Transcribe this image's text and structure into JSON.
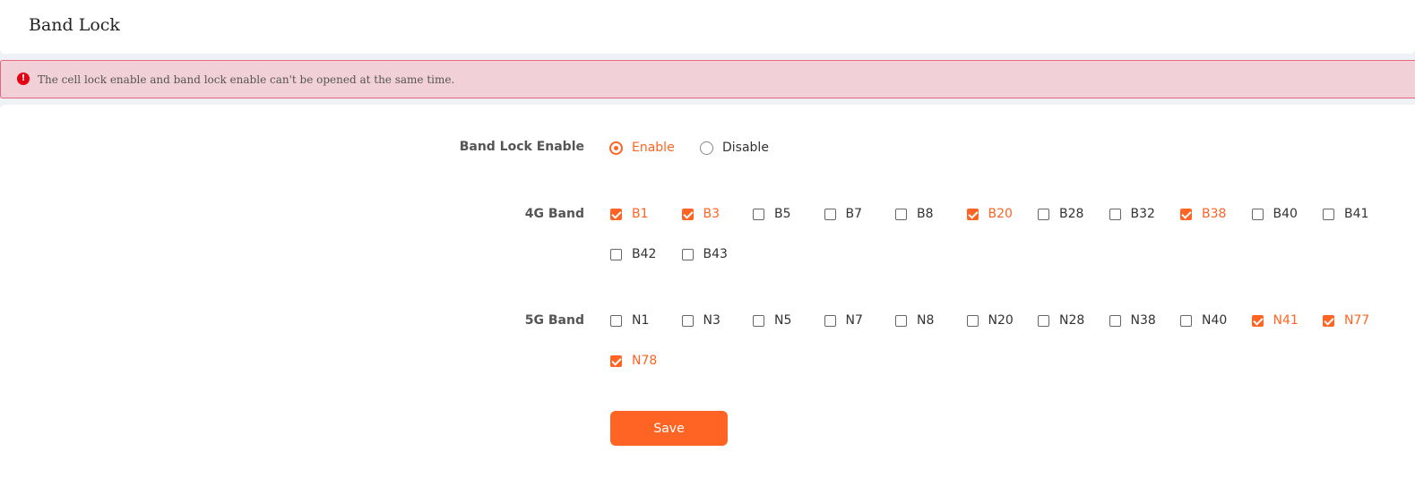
{
  "header": {
    "title": "Band Lock"
  },
  "alert": {
    "icon": "error-icon",
    "text": "The cell lock enable and band lock enable can't be opened at the same time."
  },
  "form": {
    "band_lock_enable": {
      "label": "Band Lock Enable",
      "options": [
        {
          "label": "Enable",
          "selected": true
        },
        {
          "label": "Disable",
          "selected": false
        }
      ]
    },
    "band_4g": {
      "label": "4G Band",
      "bands": [
        {
          "label": "B1",
          "checked": true
        },
        {
          "label": "B3",
          "checked": true
        },
        {
          "label": "B5",
          "checked": false
        },
        {
          "label": "B7",
          "checked": false
        },
        {
          "label": "B8",
          "checked": false
        },
        {
          "label": "B20",
          "checked": true
        },
        {
          "label": "B28",
          "checked": false
        },
        {
          "label": "B32",
          "checked": false
        },
        {
          "label": "B38",
          "checked": true
        },
        {
          "label": "B40",
          "checked": false
        },
        {
          "label": "B41",
          "checked": false
        },
        {
          "label": "B42",
          "checked": false
        },
        {
          "label": "B43",
          "checked": false
        }
      ]
    },
    "band_5g": {
      "label": "5G Band",
      "bands": [
        {
          "label": "N1",
          "checked": false
        },
        {
          "label": "N3",
          "checked": false
        },
        {
          "label": "N5",
          "checked": false
        },
        {
          "label": "N7",
          "checked": false
        },
        {
          "label": "N8",
          "checked": false
        },
        {
          "label": "N20",
          "checked": false
        },
        {
          "label": "N28",
          "checked": false
        },
        {
          "label": "N38",
          "checked": false
        },
        {
          "label": "N40",
          "checked": false
        },
        {
          "label": "N41",
          "checked": true
        },
        {
          "label": "N77",
          "checked": true
        },
        {
          "label": "N78",
          "checked": true
        }
      ]
    },
    "save_label": "Save"
  },
  "colors": {
    "accent": "#ff6424",
    "alert_bg": "#f2d0d7",
    "alert_border": "#e8677f",
    "alert_icon": "#e60012"
  }
}
